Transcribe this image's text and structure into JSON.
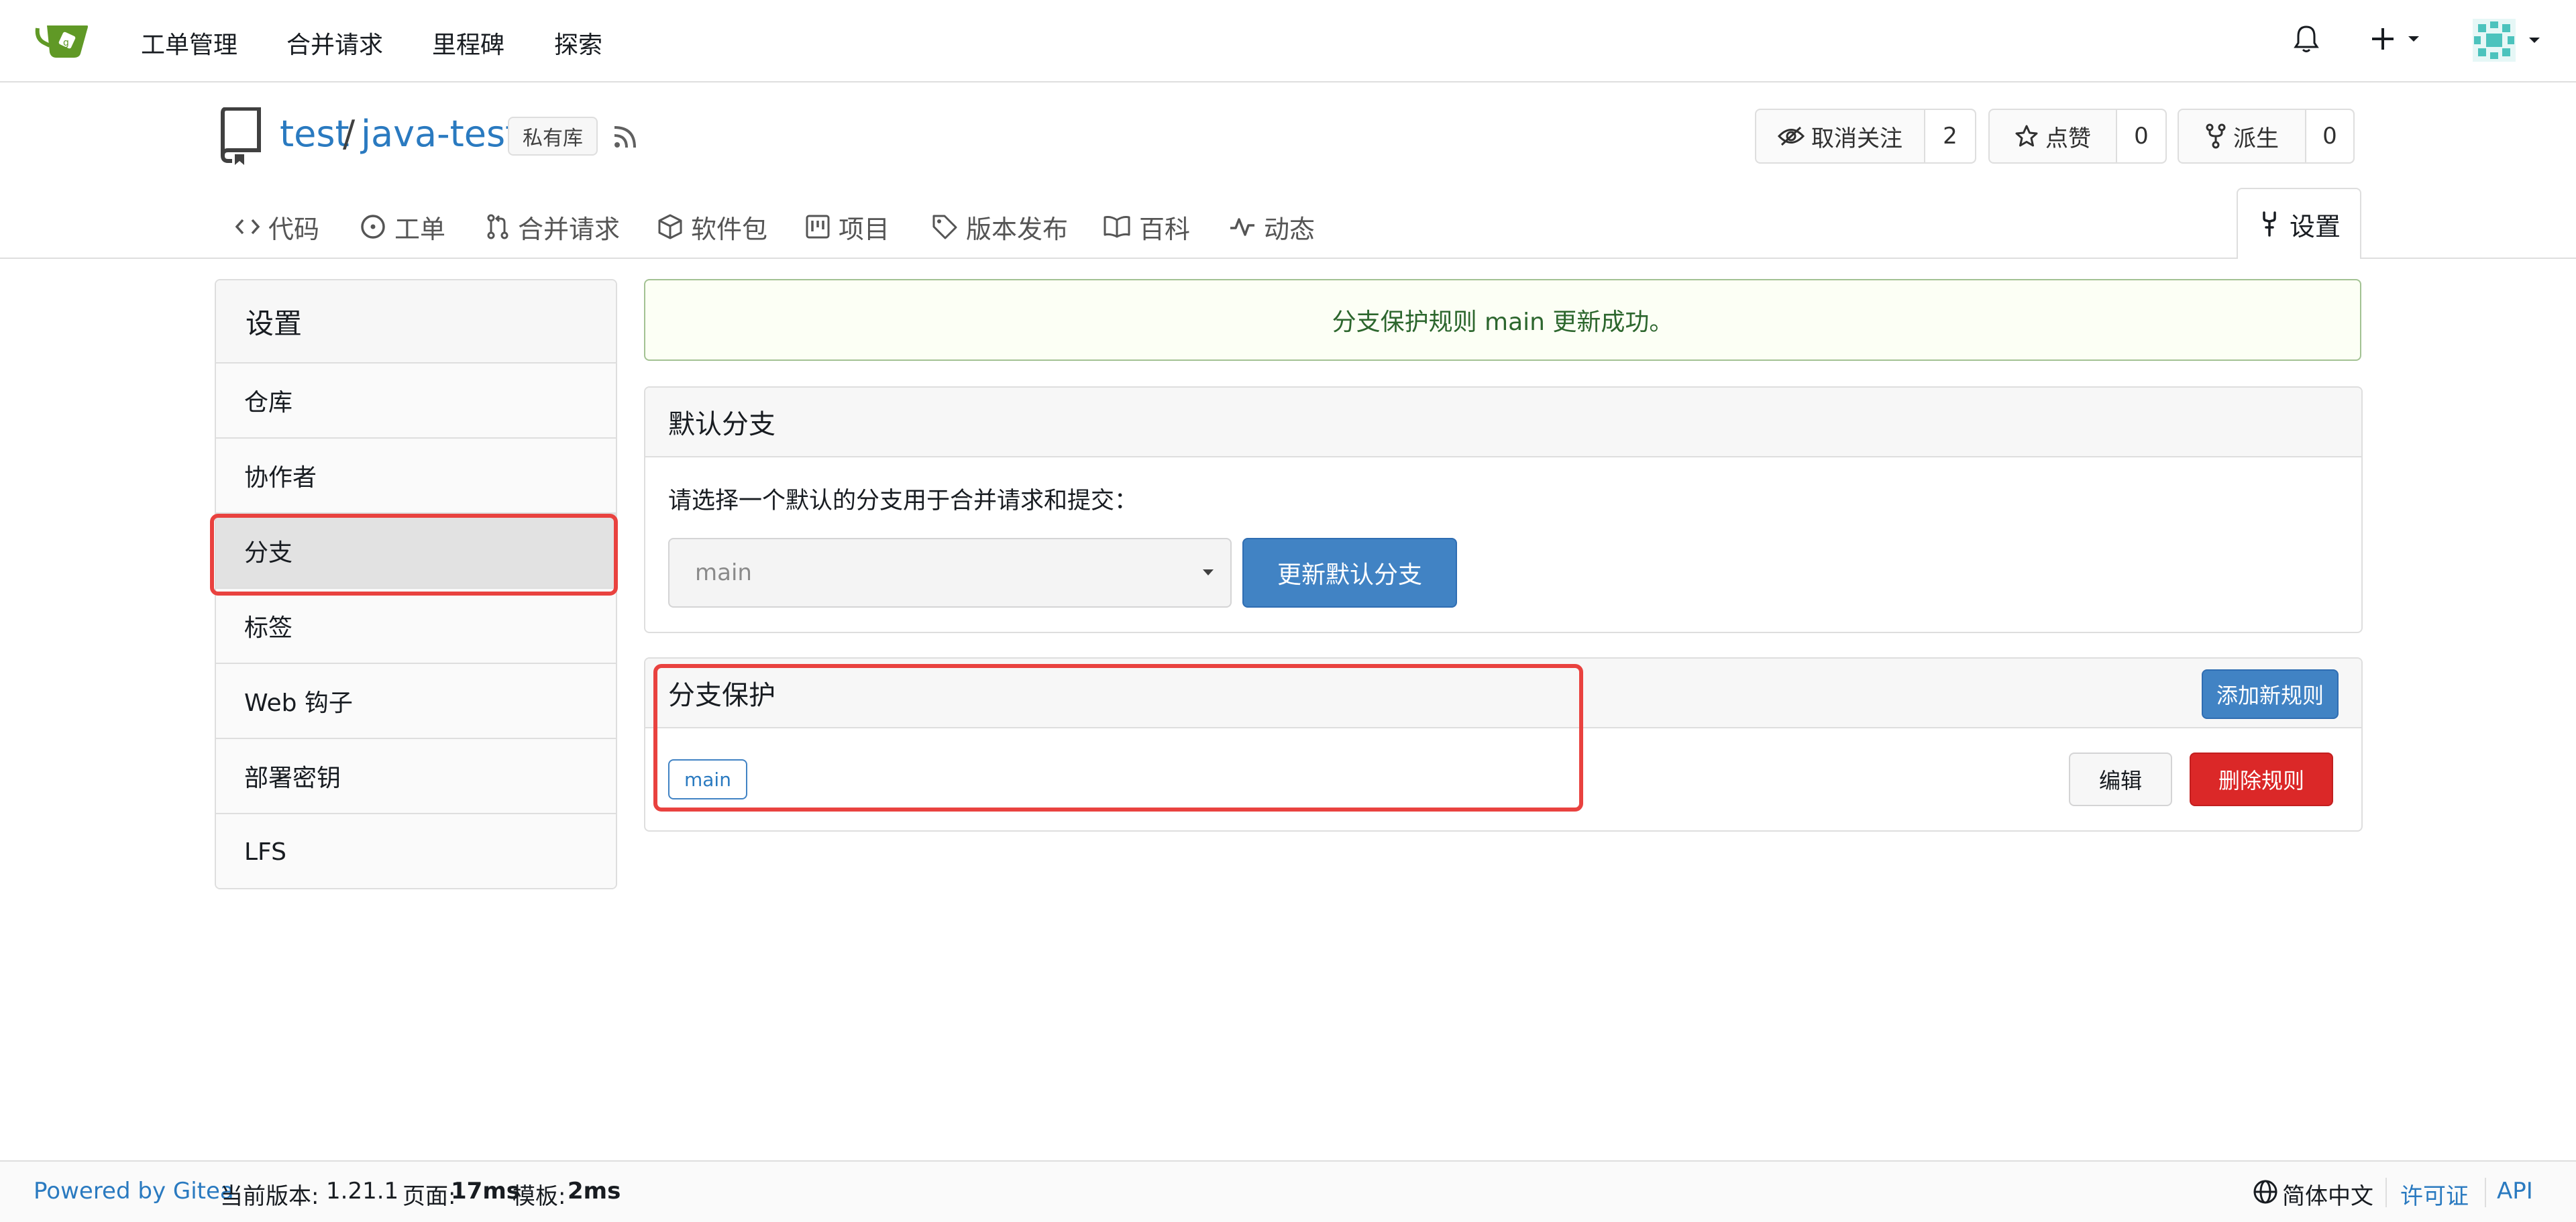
{
  "nav": {
    "items": [
      "工单管理",
      "合并请求",
      "里程碑",
      "探索"
    ],
    "logo_icon": "gitea-logo-icon",
    "brand_color": "#609926"
  },
  "repo": {
    "owner": "test",
    "separator": "/",
    "name": "java-test",
    "visibility_badge": "私有库",
    "watch": {
      "label": "取消关注",
      "count": "2"
    },
    "star": {
      "label": "点赞",
      "count": "0"
    },
    "fork": {
      "label": "派生",
      "count": "0"
    }
  },
  "tabs": [
    {
      "label": "代码",
      "icon": "code-icon"
    },
    {
      "label": "工单",
      "icon": "issue-icon"
    },
    {
      "label": "合并请求",
      "icon": "pull-request-icon"
    },
    {
      "label": "软件包",
      "icon": "package-icon"
    },
    {
      "label": "项目",
      "icon": "project-icon"
    },
    {
      "label": "版本发布",
      "icon": "tag-icon"
    },
    {
      "label": "百科",
      "icon": "book-icon"
    },
    {
      "label": "动态",
      "icon": "pulse-icon"
    },
    {
      "label": "设置",
      "icon": "tools-icon",
      "active": true
    }
  ],
  "sidebar": {
    "title": "设置",
    "items": [
      {
        "label": "仓库"
      },
      {
        "label": "协作者"
      },
      {
        "label": "分支",
        "active": true
      },
      {
        "label": "标签"
      },
      {
        "label": "Web 钩子"
      },
      {
        "label": "部署密钥"
      },
      {
        "label": "LFS"
      }
    ]
  },
  "flash": {
    "message": "分支保护规则 main 更新成功。"
  },
  "default_branch": {
    "title": "默认分支",
    "description": "请选择一个默认的分支用于合并请求和提交：",
    "selected": "main",
    "button": "更新默认分支"
  },
  "protection": {
    "title": "分支保护",
    "add_button": "添加新规则",
    "rules": [
      {
        "branch": "main",
        "edit": "编辑",
        "delete": "删除规则"
      }
    ]
  },
  "footer": {
    "powered_by": "Powered by Gitea",
    "version_label": "当前版本:",
    "version": "1.21.1",
    "page_label": "页面:",
    "page_time": "17ms",
    "template_label": "模板:",
    "template_time": "2ms",
    "language": "简体中文",
    "license": "许可证",
    "api": "API"
  },
  "colors": {
    "link": "#2a7ac0",
    "primary_button": "#4183c4",
    "danger_button": "#db2828",
    "success_text": "#2c662d",
    "annotation": "#e9423f"
  }
}
